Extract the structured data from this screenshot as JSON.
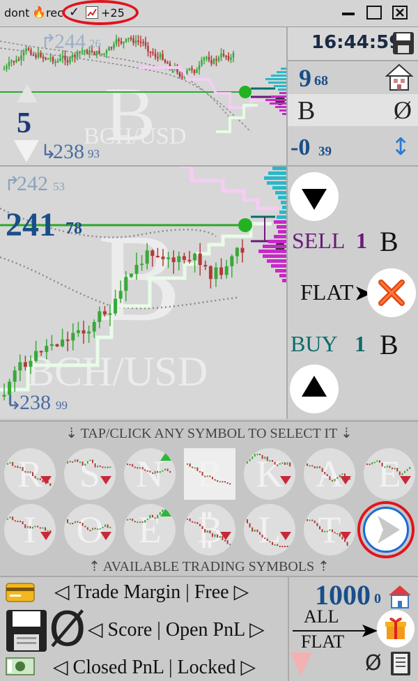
{
  "titlebar": {
    "app_title": "dont",
    "app_title_suffix": "rec",
    "check_label": "✓",
    "badge_count": "+25"
  },
  "top_chart": {
    "symbol_letter": "B",
    "watermark": "BCH/USD",
    "high_arrow": "↱",
    "high_value_big": "244",
    "high_value_small": "26",
    "low_arrow": "↳",
    "low_value_big": "238",
    "low_value_small": "93",
    "volume_number": "5"
  },
  "top_panel": {
    "clock": "16:44:59",
    "price_big": "9",
    "price_small": "68",
    "selected_symbol": "B",
    "position_symbol": "Ø",
    "pnl_big": "-0",
    "pnl_small": "39",
    "updown_icon": "↕"
  },
  "main_chart": {
    "symbol_letter": "B",
    "watermark": "BCH/USD",
    "high_arrow": "↱",
    "high_value_big": "242",
    "high_value_small": "53",
    "price_big": "241",
    "price_small": "78",
    "low_arrow": "↳",
    "low_value_big": "238",
    "low_value_small": "99"
  },
  "trade_panel": {
    "sell_label": "SELL",
    "sell_qty": "1",
    "sell_symbol": "B",
    "flat_label": "FLAT",
    "buy_label": "BUY",
    "buy_qty": "1",
    "buy_symbol": "B"
  },
  "symbols": {
    "header": "⇣ TAP/CLICK ANY SYMBOL TO SELECT IT ⇣",
    "footer": "⇡ AVAILABLE TRADING SYMBOLS ⇡",
    "row1": [
      {
        "letter": "R",
        "trend": "down"
      },
      {
        "letter": "S",
        "trend": "down"
      },
      {
        "letter": "N",
        "trend": "up"
      },
      {
        "letter": "B",
        "trend": "none",
        "selected": true
      },
      {
        "letter": "K",
        "trend": "down"
      },
      {
        "letter": "A",
        "trend": "down"
      },
      {
        "letter": "E",
        "trend": "down"
      }
    ],
    "row2": [
      {
        "letter": "I",
        "trend": "down"
      },
      {
        "letter": "O",
        "trend": "down"
      },
      {
        "letter": "E",
        "trend": "up"
      },
      {
        "letter": "₿",
        "trend": "down"
      },
      {
        "letter": "L",
        "trend": "down"
      },
      {
        "letter": "T",
        "trend": "down"
      }
    ]
  },
  "bottom": {
    "line1": "◁ Trade Margin | Free ▷",
    "null_symbol": "Ø",
    "line2": "◁ Score | Open PnL ▷",
    "line3": "◁ Closed PnL | Locked ▷",
    "balance_big": "1000",
    "balance_small": "0",
    "all_label": "ALL",
    "flat_label": "FLAT",
    "right_null": "Ø"
  },
  "colors": {
    "accent_blue": "#1a4e8a",
    "sell_purple": "#6a1a7a",
    "buy_teal": "#0e6a6a",
    "candle_up": "#39a83a",
    "candle_down": "#b53838",
    "highlight_red": "#e0141c"
  },
  "icons": [
    "fire-icon",
    "chart-icon",
    "maximize-icon",
    "close-icon",
    "save-icon",
    "home-icon",
    "updown-icon",
    "down-triangle-icon",
    "x-icon",
    "up-triangle-icon",
    "next-arrow-icon",
    "card-icon",
    "floppy-icon",
    "money-icon",
    "gift-icon",
    "book-icon"
  ]
}
